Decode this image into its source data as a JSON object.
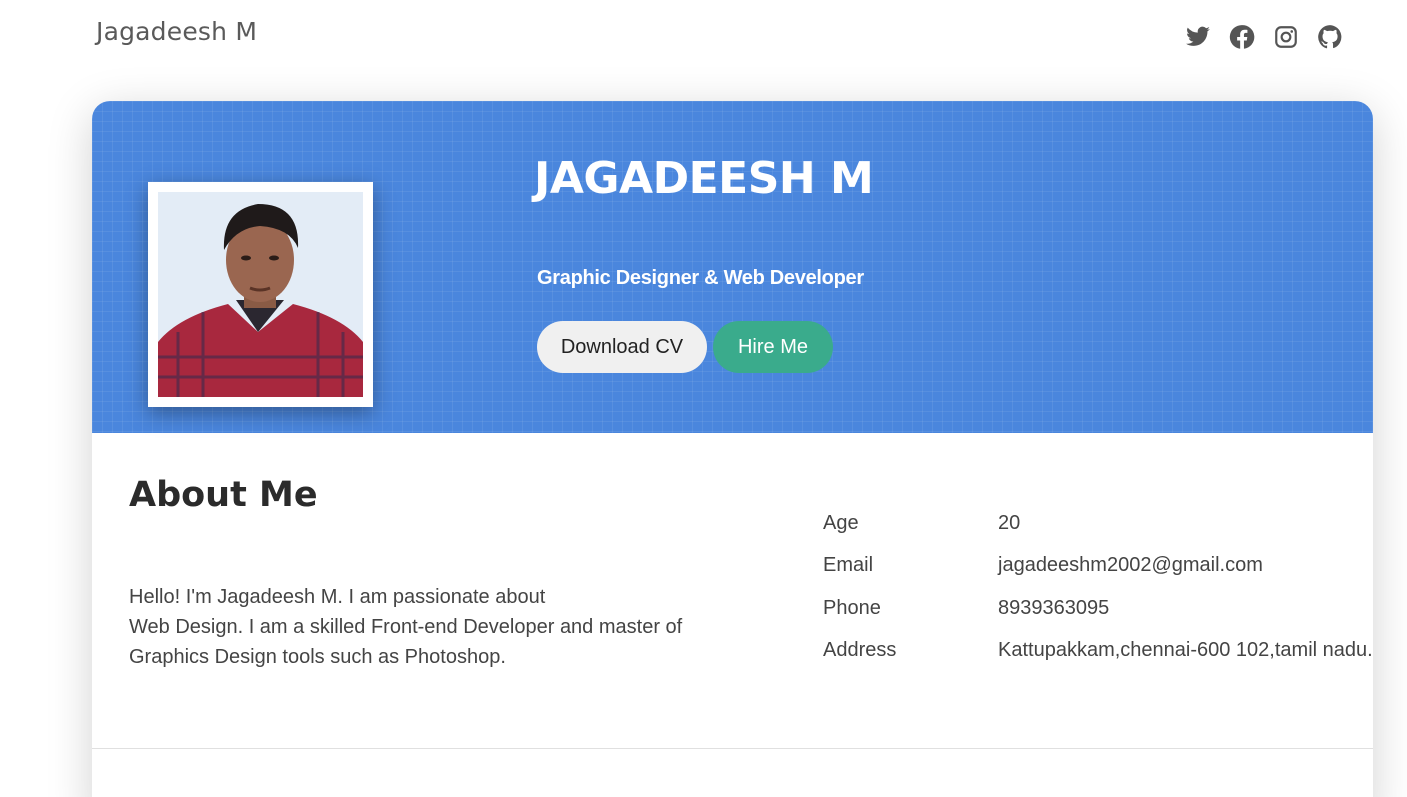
{
  "header": {
    "brand": "Jagadeesh M",
    "social": [
      {
        "icon": "twitter-icon"
      },
      {
        "icon": "facebook-icon"
      },
      {
        "icon": "instagram-icon"
      },
      {
        "icon": "github-icon"
      }
    ]
  },
  "hero": {
    "name": "JAGADEESH M",
    "title": "Graphic Designer & Web Developer",
    "download_label": "Download CV",
    "hire_label": "Hire Me",
    "accent_color": "#4a86dd",
    "hire_color": "#3aab8c"
  },
  "about": {
    "heading": "About Me",
    "lines": [
      "Hello! I'm Jagadeesh M. I am passionate about",
      "Web Design. I am a skilled Front-end Developer and master of",
      "Graphics Design tools such as Photoshop."
    ],
    "info": [
      {
        "label": "Age",
        "value": "20"
      },
      {
        "label": "Email",
        "value": "jagadeeshm2002@gmail.com"
      },
      {
        "label": "Phone",
        "value": "8939363095"
      },
      {
        "label": "Address",
        "value": "Kattupakkam,chennai-600 102,tamil nadu."
      }
    ]
  }
}
